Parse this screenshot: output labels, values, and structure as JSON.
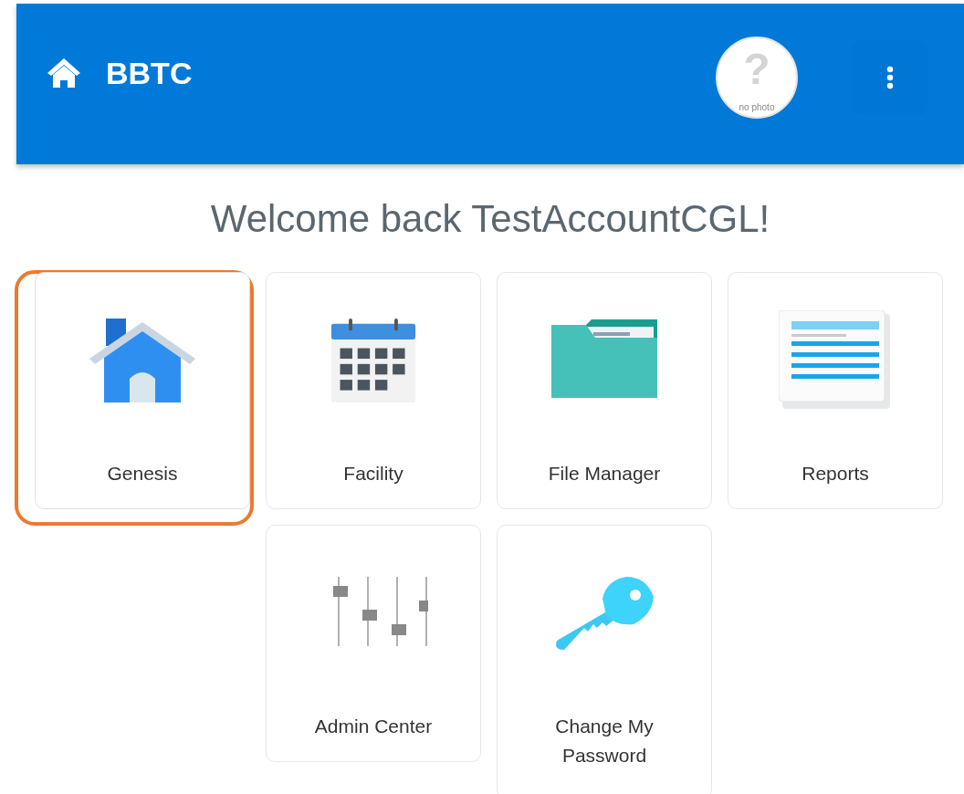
{
  "header": {
    "title": "BBTC",
    "avatar": {
      "glyph": "?",
      "caption": "no photo"
    }
  },
  "welcome": "Welcome back TestAccountCGL!",
  "tiles": [
    {
      "label": "Genesis",
      "kind": "house",
      "selected": true
    },
    {
      "label": "Facility",
      "kind": "calendar",
      "selected": false
    },
    {
      "label": "File Manager",
      "kind": "folder",
      "selected": false
    },
    {
      "label": "Reports",
      "kind": "document",
      "selected": false
    },
    {
      "label": "Admin Center",
      "kind": "sliders",
      "selected": false
    },
    {
      "label": "Change My Password",
      "kind": "key",
      "selected": false
    }
  ]
}
